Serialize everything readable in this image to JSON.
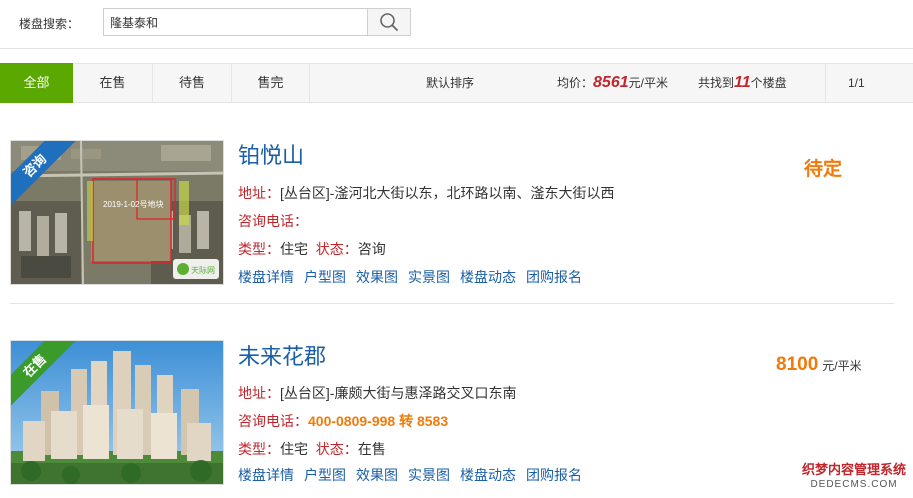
{
  "search": {
    "label": "楼盘搜索：",
    "value": "隆基泰和"
  },
  "tabs": [
    {
      "label": "全部",
      "active": true
    },
    {
      "label": "在售",
      "active": false
    },
    {
      "label": "待售",
      "active": false
    },
    {
      "label": "售完",
      "active": false
    }
  ],
  "toolbar": {
    "sort_label": "默认排序",
    "avg_prefix": "均价：",
    "avg_value": "8561",
    "avg_unit": "元/平米",
    "found_prefix": "共找到",
    "found_count": "11",
    "found_suffix": "个楼盘",
    "pager": "1/1"
  },
  "listings": [
    {
      "ribbon": "咨询",
      "ribbon_color": "#1f6fbf",
      "title": "铂悦山",
      "address_label": "地址：",
      "address": "[丛台区]-滏河北大街以东，北环路以南、滏东大街以西",
      "phone_label": "咨询电话：",
      "phone": "",
      "type_label": "类型：",
      "type": "住宅",
      "status_label": "状态：",
      "status": "咨询",
      "price_text": "待定",
      "image_text": "2019-1-02号地块",
      "image_logo": "天际网",
      "links": [
        "楼盘详情",
        "户型图",
        "效果图",
        "实景图",
        "楼盘动态",
        "团购报名"
      ]
    },
    {
      "ribbon": "在售",
      "ribbon_color": "#3a9a2a",
      "title": "未来花郡",
      "address_label": "地址：",
      "address": "[丛台区]-廉颇大街与惠泽路交叉口东南",
      "phone_label": "咨询电话：",
      "phone": "400-0809-998 转 8583",
      "type_label": "类型：",
      "type": "住宅",
      "status_label": "状态：",
      "status": "在售",
      "price_value": "8100",
      "price_unit": "元/平米",
      "links": [
        "楼盘详情",
        "户型图",
        "效果图",
        "实景图",
        "楼盘动态",
        "团购报名"
      ]
    }
  ],
  "watermark": {
    "line1": "织梦内容管理系统",
    "line2": "DEDECMS.COM"
  }
}
